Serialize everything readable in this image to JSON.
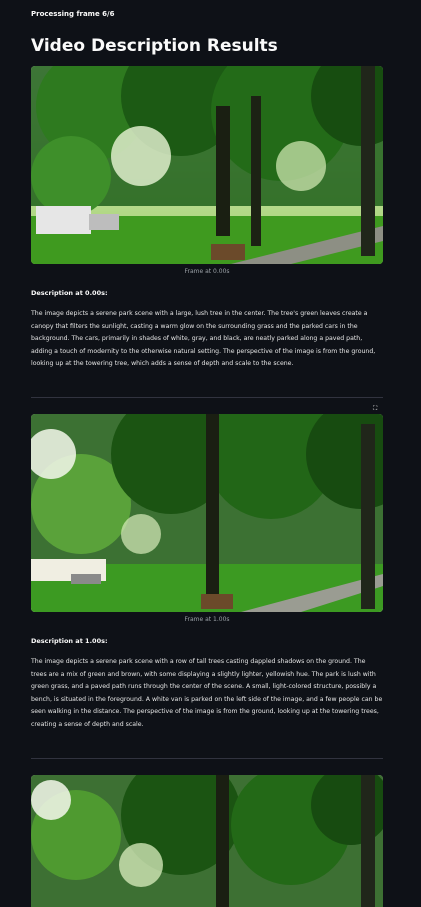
{
  "status": "Processing frame 6/6",
  "title": "Video Description Results",
  "icons": {
    "expand": "expand-icon"
  },
  "frames": [
    {
      "caption": "Frame at 0.00s",
      "heading": "Description at 0.00s:",
      "text": "The image depicts a serene park scene with a large, lush tree in the center. The tree's green leaves create a canopy that filters the sunlight, casting a warm glow on the surrounding grass and the parked cars in the background. The cars, primarily in shades of white, gray, and black, are neatly parked along a paved path, adding a touch of modernity to the otherwise natural setting. The perspective of the image is from the ground, looking up at the towering tree, which adds a sense of depth and scale to the scene."
    },
    {
      "caption": "Frame at 1.00s",
      "heading": "Description at 1.00s:",
      "text": "The image depicts a serene park scene with a row of tall trees casting dappled shadows on the ground. The trees are a mix of green and brown, with some displaying a slightly lighter, yellowish hue. The park is lush with green grass, and a paved path runs through the center of the scene. A small, light-colored structure, possibly a bench, is situated in the foreground. A white van is parked on the left side of the image, and a few people can be seen walking in the distance. The perspective of the image is from the ground, looking up at the towering trees, creating a sense of depth and scale."
    }
  ]
}
